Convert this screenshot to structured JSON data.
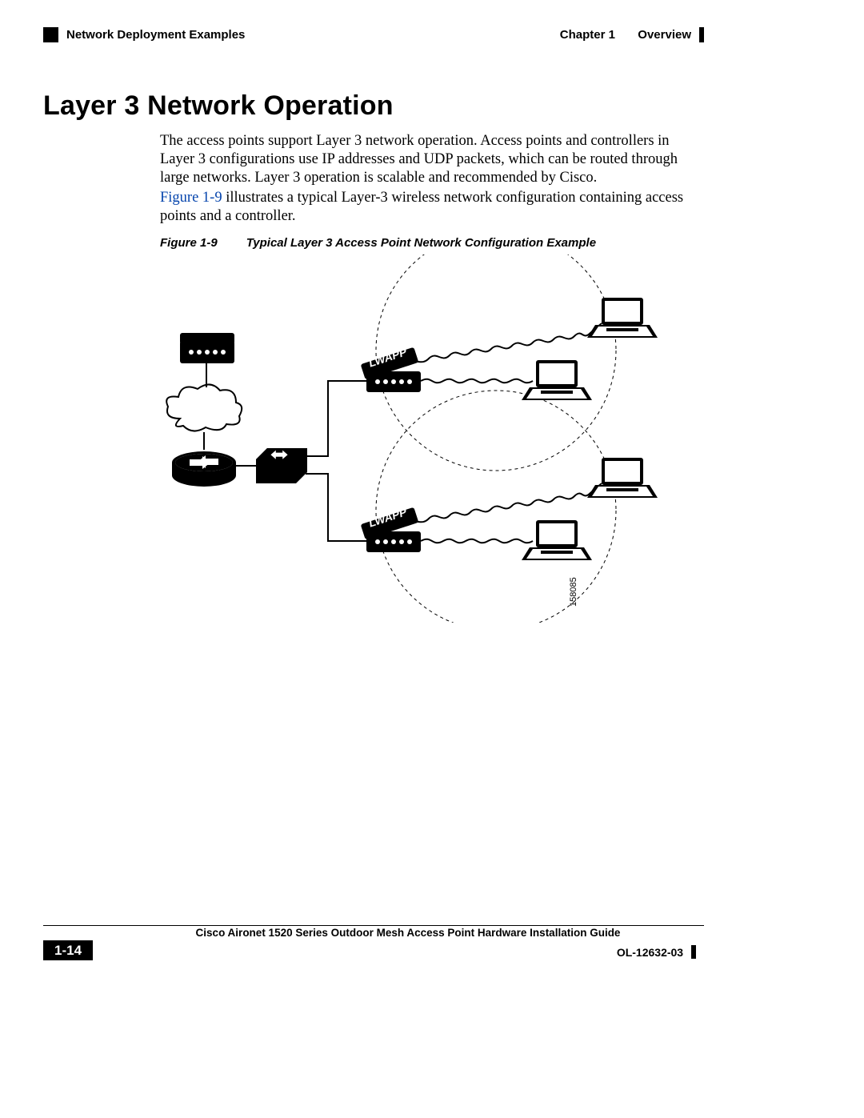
{
  "header": {
    "section_label": "Network Deployment Examples",
    "chapter_label": "Chapter 1",
    "chapter_title": "Overview"
  },
  "heading": "Layer 3 Network Operation",
  "paragraphs": {
    "p1": "The access points support Layer 3 network operation. Access points and controllers in Layer 3 configurations use IP addresses and UDP packets, which can be routed through large networks. Layer 3 operation is scalable and recommended by Cisco.",
    "p2_link": "Figure 1-9",
    "p2_rest": " illustrates a typical Layer-3 wireless network configuration containing access points and a controller."
  },
  "figure": {
    "label": "Figure 1-9",
    "title": "Typical Layer 3 Access Point Network Configuration Example",
    "device_label": "LWAPP",
    "image_id": "158085"
  },
  "footer": {
    "guide_title": "Cisco Aironet 1520 Series Outdoor Mesh Access Point Hardware Installation Guide",
    "page_number": "1-14",
    "doc_number": "OL-12632-03"
  }
}
